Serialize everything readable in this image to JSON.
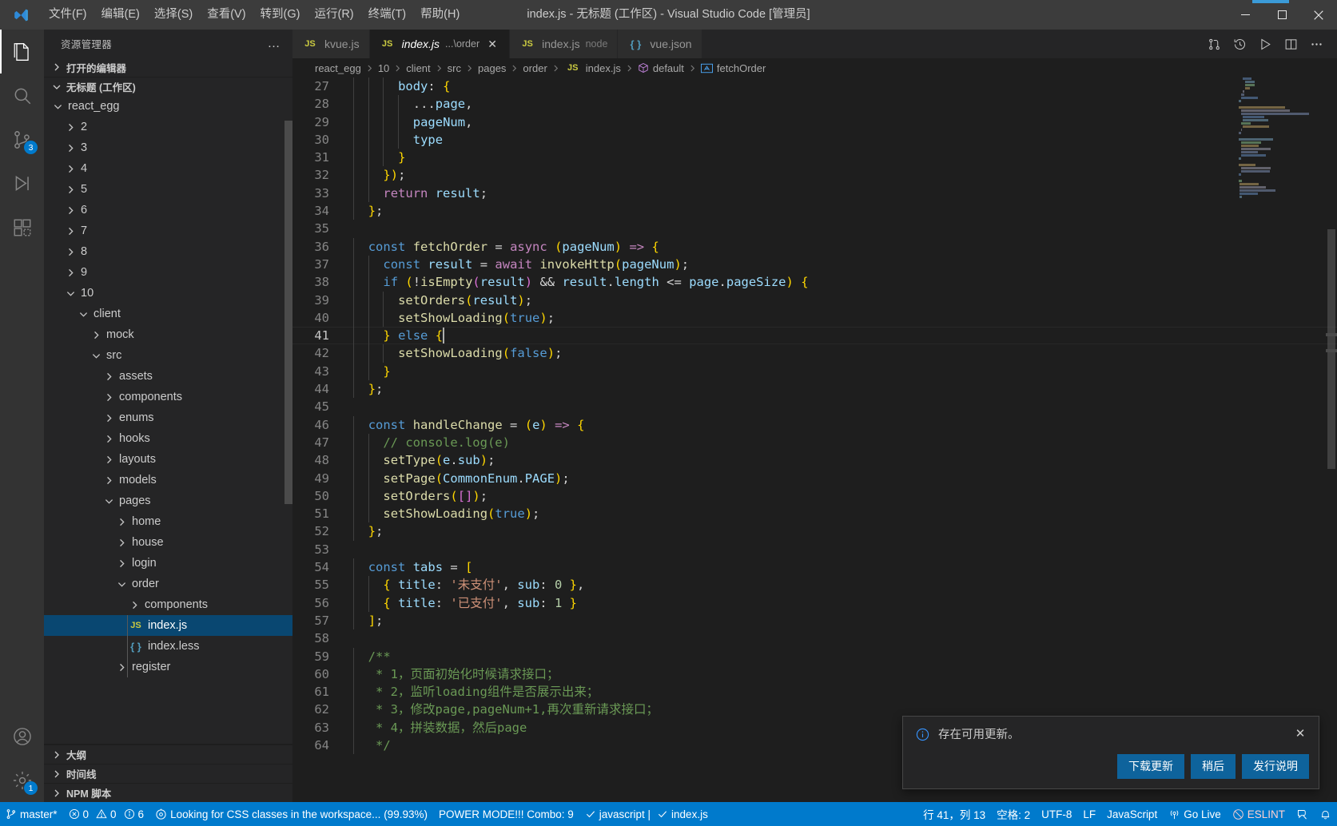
{
  "titlebar": {
    "menus": [
      "文件(F)",
      "编辑(E)",
      "选择(S)",
      "查看(V)",
      "转到(G)",
      "运行(R)",
      "终端(T)",
      "帮助(H)"
    ],
    "window_title": "index.js - 无标题 (工作区) - Visual Studio Code [管理员]",
    "controls": {
      "minimize": "—",
      "maximize": "▢",
      "close": "✕"
    }
  },
  "activitybar": {
    "items": [
      {
        "name": "explorer",
        "icon": "files-icon",
        "badge": ""
      },
      {
        "name": "search",
        "icon": "search-icon",
        "badge": ""
      },
      {
        "name": "source-control",
        "icon": "source-control-icon",
        "badge": "3"
      },
      {
        "name": "run-and-debug",
        "icon": "debug-icon",
        "badge": ""
      },
      {
        "name": "extensions",
        "icon": "extensions-icon",
        "badge": ""
      }
    ],
    "bottom": [
      {
        "name": "accounts",
        "icon": "account-icon",
        "badge": ""
      },
      {
        "name": "manage",
        "icon": "gear-icon",
        "badge": "1"
      }
    ]
  },
  "sidebar": {
    "title": "资源管理器",
    "more_actions": "…",
    "sections": [
      {
        "label": "打开的编辑器",
        "expanded": false
      },
      {
        "label": "无标题 (工作区)",
        "expanded": true
      }
    ],
    "tree": [
      {
        "label": "react_egg",
        "depth": 1,
        "type": "folder",
        "expanded": true
      },
      {
        "label": "2",
        "depth": 2,
        "type": "folder",
        "expanded": false
      },
      {
        "label": "3",
        "depth": 2,
        "type": "folder",
        "expanded": false
      },
      {
        "label": "4",
        "depth": 2,
        "type": "folder",
        "expanded": false
      },
      {
        "label": "5",
        "depth": 2,
        "type": "folder",
        "expanded": false
      },
      {
        "label": "6",
        "depth": 2,
        "type": "folder",
        "expanded": false
      },
      {
        "label": "7",
        "depth": 2,
        "type": "folder",
        "expanded": false
      },
      {
        "label": "8",
        "depth": 2,
        "type": "folder",
        "expanded": false
      },
      {
        "label": "9",
        "depth": 2,
        "type": "folder",
        "expanded": false
      },
      {
        "label": "10",
        "depth": 2,
        "type": "folder",
        "expanded": true
      },
      {
        "label": "client",
        "depth": 3,
        "type": "folder",
        "expanded": true
      },
      {
        "label": "mock",
        "depth": 4,
        "type": "folder",
        "expanded": false
      },
      {
        "label": "src",
        "depth": 4,
        "type": "folder",
        "expanded": true
      },
      {
        "label": "assets",
        "depth": 5,
        "type": "folder",
        "expanded": false
      },
      {
        "label": "components",
        "depth": 5,
        "type": "folder",
        "expanded": false
      },
      {
        "label": "enums",
        "depth": 5,
        "type": "folder",
        "expanded": false
      },
      {
        "label": "hooks",
        "depth": 5,
        "type": "folder",
        "expanded": false
      },
      {
        "label": "layouts",
        "depth": 5,
        "type": "folder",
        "expanded": false
      },
      {
        "label": "models",
        "depth": 5,
        "type": "folder",
        "expanded": false
      },
      {
        "label": "pages",
        "depth": 5,
        "type": "folder",
        "expanded": true
      },
      {
        "label": "home",
        "depth": 6,
        "type": "folder",
        "expanded": false
      },
      {
        "label": "house",
        "depth": 6,
        "type": "folder",
        "expanded": false
      },
      {
        "label": "login",
        "depth": 6,
        "type": "folder",
        "expanded": false
      },
      {
        "label": "order",
        "depth": 6,
        "type": "folder",
        "expanded": true
      },
      {
        "label": "components",
        "depth": 7,
        "type": "folder",
        "expanded": false
      },
      {
        "label": "index.js",
        "depth": 7,
        "type": "js",
        "selected": true
      },
      {
        "label": "index.less",
        "depth": 7,
        "type": "less"
      },
      {
        "label": "register",
        "depth": 6,
        "type": "folder",
        "expanded": false
      }
    ],
    "bottom_sections": [
      "大纲",
      "时间线",
      "NPM 脚本"
    ]
  },
  "tabs": [
    {
      "icon": "js-file-icon",
      "name": "kvue.js",
      "desc": "",
      "active": false,
      "closable": false
    },
    {
      "icon": "js-file-icon",
      "name": "index.js",
      "desc": "...\\order",
      "active": true,
      "closable": true
    },
    {
      "icon": "js-file-icon",
      "name": "index.js",
      "desc": "node",
      "active": false,
      "closable": false
    },
    {
      "icon": "json-file-icon",
      "name": "vue.json",
      "desc": "",
      "active": false,
      "closable": false
    }
  ],
  "tab_actions": [
    "split-diff-icon",
    "history-icon",
    "run-icon",
    "split-editor-icon",
    "more-actions-icon"
  ],
  "breadcrumbs": [
    {
      "label": "react_egg",
      "icon": ""
    },
    {
      "label": "10",
      "icon": ""
    },
    {
      "label": "client",
      "icon": ""
    },
    {
      "label": "src",
      "icon": ""
    },
    {
      "label": "pages",
      "icon": ""
    },
    {
      "label": "order",
      "icon": ""
    },
    {
      "label": "index.js",
      "icon": "js-file-icon"
    },
    {
      "label": "default",
      "icon": "module-icon"
    },
    {
      "label": "fetchOrder",
      "icon": "field-icon"
    }
  ],
  "editor": {
    "first_line": 27,
    "current_line": 41,
    "cursor_column": 13,
    "lines": [
      {
        "n": 27,
        "text": "      body: {"
      },
      {
        "n": 28,
        "text": "        ...page,"
      },
      {
        "n": 29,
        "text": "        pageNum,"
      },
      {
        "n": 30,
        "text": "        type"
      },
      {
        "n": 31,
        "text": "      }"
      },
      {
        "n": 32,
        "text": "    });"
      },
      {
        "n": 33,
        "text": "    return result;"
      },
      {
        "n": 34,
        "text": "  };"
      },
      {
        "n": 35,
        "text": ""
      },
      {
        "n": 36,
        "text": "  const fetchOrder = async (pageNum) => {"
      },
      {
        "n": 37,
        "text": "    const result = await invokeHttp(pageNum);"
      },
      {
        "n": 38,
        "text": "    if (!isEmpty(result) && result.length <= page.pageSize) {"
      },
      {
        "n": 39,
        "text": "      setOrders(result);"
      },
      {
        "n": 40,
        "text": "      setShowLoading(true);"
      },
      {
        "n": 41,
        "text": "    } else {"
      },
      {
        "n": 42,
        "text": "      setShowLoading(false);"
      },
      {
        "n": 43,
        "text": "    }"
      },
      {
        "n": 44,
        "text": "  };"
      },
      {
        "n": 45,
        "text": ""
      },
      {
        "n": 46,
        "text": "  const handleChange = (e) => {"
      },
      {
        "n": 47,
        "text": "    // console.log(e)"
      },
      {
        "n": 48,
        "text": "    setType(e.sub);"
      },
      {
        "n": 49,
        "text": "    setPage(CommonEnum.PAGE);"
      },
      {
        "n": 50,
        "text": "    setOrders([]);"
      },
      {
        "n": 51,
        "text": "    setShowLoading(true);"
      },
      {
        "n": 52,
        "text": "  };"
      },
      {
        "n": 53,
        "text": ""
      },
      {
        "n": 54,
        "text": "  const tabs = ["
      },
      {
        "n": 55,
        "text": "    { title: '未支付', sub: 0 },"
      },
      {
        "n": 56,
        "text": "    { title: '已支付', sub: 1 }"
      },
      {
        "n": 57,
        "text": "  ];"
      },
      {
        "n": 58,
        "text": ""
      },
      {
        "n": 59,
        "text": "  /**"
      },
      {
        "n": 60,
        "text": "   * 1，页面初始化时候请求接口；"
      },
      {
        "n": 61,
        "text": "   * 2，监听loading组件是否展示出来；"
      },
      {
        "n": 62,
        "text": "   * 3，修改page,pageNum+1,再次重新请求接口；"
      },
      {
        "n": 63,
        "text": "   * 4，拼装数据，然后page"
      },
      {
        "n": 64,
        "text": "   */"
      }
    ]
  },
  "notification": {
    "icon": "info-icon",
    "message": "存在可用更新。",
    "close": "✕",
    "buttons": [
      "下载更新",
      "稍后",
      "发行说明"
    ]
  },
  "statusbar": {
    "left": [
      {
        "name": "branch",
        "icon": "source-control-icon",
        "label": "master*"
      },
      {
        "name": "problems",
        "icon": "error-warning-icon",
        "label": "0  0  6",
        "errors": "0",
        "warnings": "0",
        "infos": "6"
      },
      {
        "name": "css-classes",
        "icon": "eye-icon",
        "label": "Looking for CSS classes in the workspace... (99.93%)"
      },
      {
        "name": "power-mode",
        "icon": "",
        "label": "POWER MODE!!! Combo: 9"
      },
      {
        "name": "javascript-check",
        "icon": "check-icon",
        "label": "javascript |"
      },
      {
        "name": "indexjs-check",
        "icon": "check-icon",
        "label": "index.js"
      }
    ],
    "right": [
      {
        "name": "cursor-position",
        "label": "行 41，列 13"
      },
      {
        "name": "indentation",
        "label": "空格: 2"
      },
      {
        "name": "encoding",
        "label": "UTF-8"
      },
      {
        "name": "eol",
        "label": "LF"
      },
      {
        "name": "language-mode",
        "label": "JavaScript"
      },
      {
        "name": "go-live",
        "icon": "broadcast-icon",
        "label": "Go Live"
      },
      {
        "name": "eslint",
        "icon": "eslint-icon",
        "label": "ESLINT"
      },
      {
        "name": "remote-window",
        "icon": "feedback-icon",
        "label": ""
      },
      {
        "name": "notifications",
        "icon": "bell-icon",
        "label": ""
      }
    ]
  },
  "colors": {
    "accent": "#007acc",
    "titlebar_bg": "#3c3c3c",
    "sidebar_bg": "#252526",
    "editor_bg": "#1e1e1e",
    "selection_bg": "#094771",
    "button_bg": "#0e639c"
  }
}
